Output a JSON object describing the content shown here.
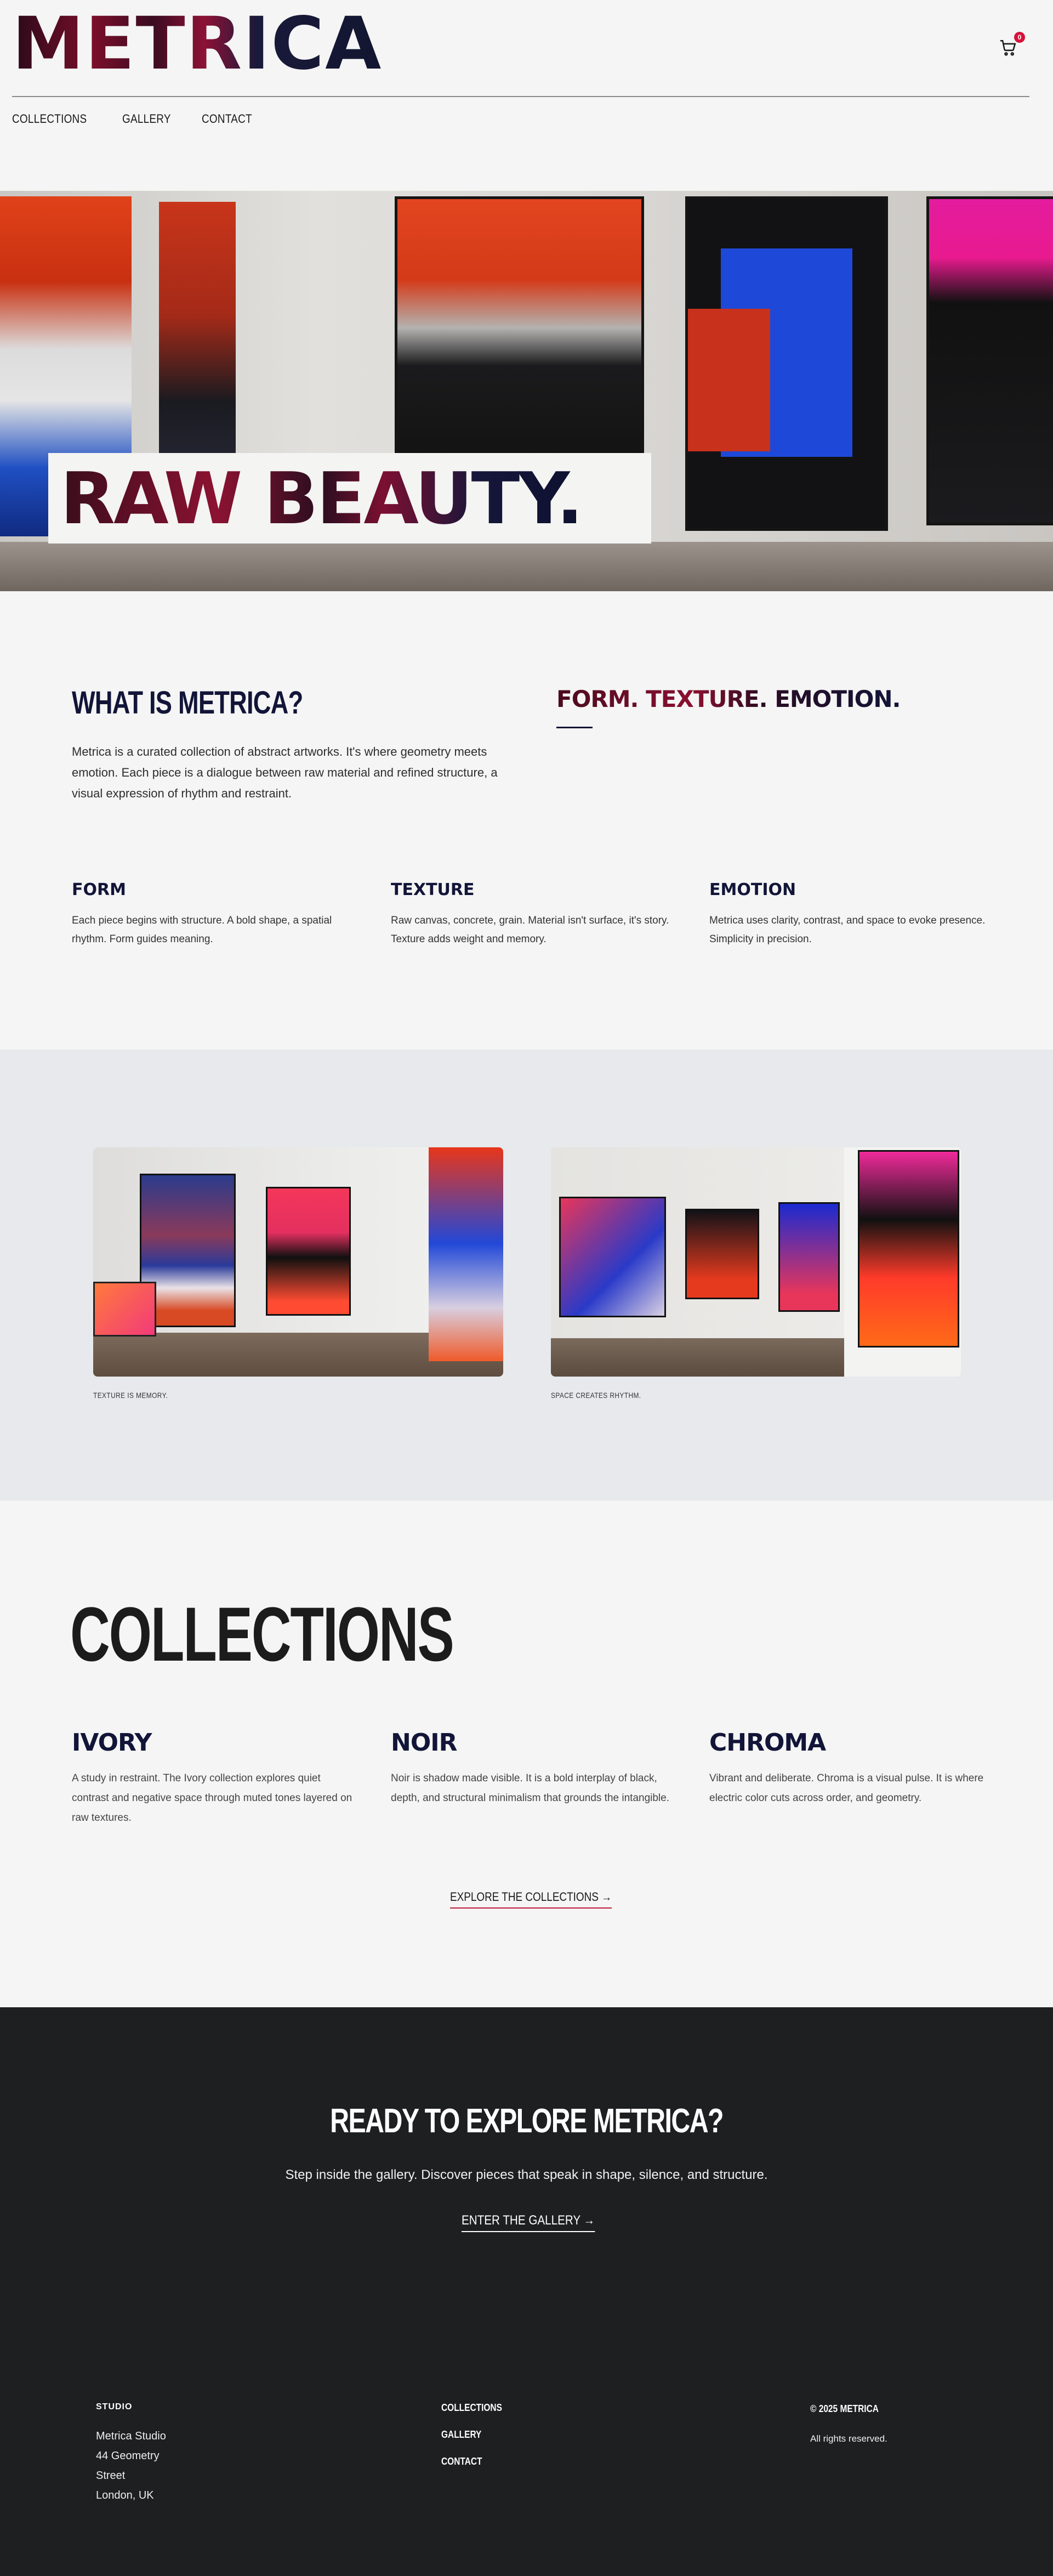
{
  "brand": {
    "logo": "METRICA",
    "cart_count": "0"
  },
  "nav": {
    "items": [
      "COLLECTIONS",
      "GALLERY",
      "CONTACT"
    ]
  },
  "hero": {
    "headline": "RAW BEAUTY."
  },
  "about": {
    "title": "WHAT IS METRICA?",
    "text": "Metrica is a curated collection of abstract artworks. It's where geometry meets emotion. Each piece is a dialogue between raw material and refined structure, a visual expression of rhythm and restraint.",
    "tagline": "FORM. TEXTURE. EMOTION.",
    "pillars": [
      {
        "title": "FORM",
        "text": "Each piece begins with structure. A bold shape, a spatial rhythm. Form guides meaning."
      },
      {
        "title": "TEXTURE",
        "text": "Raw canvas, concrete, grain. Material isn't surface, it's story. Texture adds weight and memory."
      },
      {
        "title": "EMOTION",
        "text": "Metrica uses clarity, contrast, and space to evoke presence. Simplicity in precision."
      }
    ]
  },
  "gallery": {
    "captions": [
      "TEXTURE IS MEMORY.",
      "SPACE CREATES RHYTHM."
    ]
  },
  "collections": {
    "title": "COLLECTIONS",
    "items": [
      {
        "title": "IVORY",
        "text": "A study in restraint. The Ivory collection explores quiet contrast and negative space through muted tones layered on raw textures."
      },
      {
        "title": "NOIR",
        "text": "Noir is shadow made visible. It is a bold interplay of black, depth, and structural minimalism that grounds the intangible."
      },
      {
        "title": "CHROMA",
        "text": "Vibrant and deliberate. Chroma is a visual pulse. It is where electric color cuts across order, and geometry."
      }
    ],
    "link": "EXPLORE THE COLLECTIONS →"
  },
  "cta": {
    "title": "READY TO EXPLORE METRICA?",
    "text": "Step inside the gallery. Discover pieces that speak in shape, silence, and structure.",
    "link": "ENTER THE GALLERY →"
  },
  "footer": {
    "studio_heading": "STUDIO",
    "address": [
      "Metrica Studio",
      "44 Geometry",
      "Street",
      "London, UK"
    ],
    "nav": [
      "COLLECTIONS",
      "GALLERY",
      "CONTACT"
    ],
    "copyright": "© 2025 METRICA",
    "rights": "All rights reserved."
  },
  "colors": {
    "accent": "#d8123b",
    "navy": "#121538",
    "dark": "#1e1f21",
    "background": "#f4f5f4"
  },
  "icons": [
    "cart-icon"
  ]
}
